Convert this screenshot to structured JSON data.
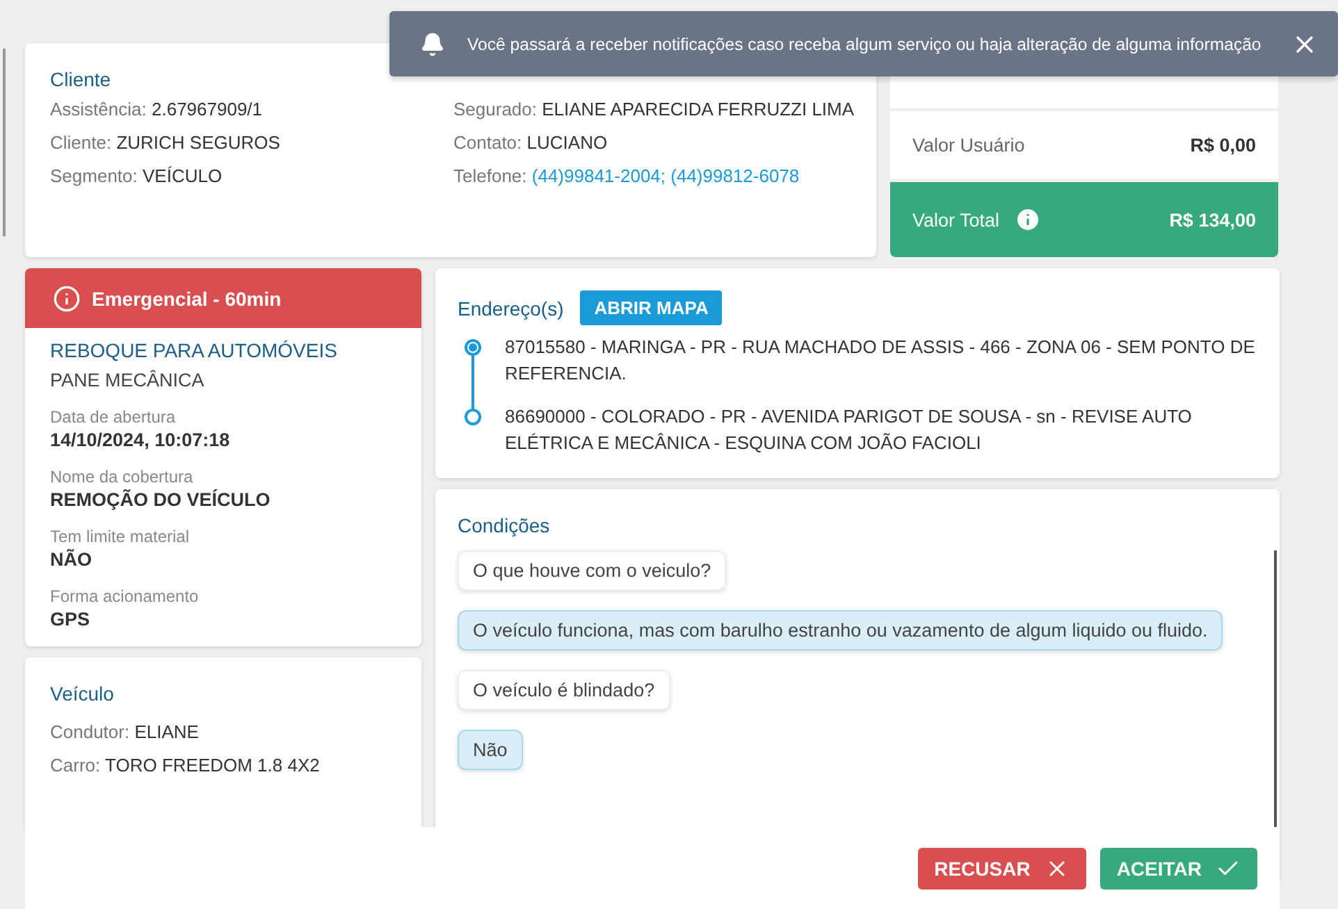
{
  "notification": {
    "text": "Você passará a receber notificações caso receba algum serviço ou haja alteração de alguma informação"
  },
  "client": {
    "title": "Cliente",
    "columns": [
      [
        {
          "label": "Assistência:",
          "value": "2.67967909/1",
          "kind": "text"
        },
        {
          "label": "Cliente:",
          "value": "ZURICH SEGUROS",
          "kind": "text"
        },
        {
          "label": "Segmento:",
          "value": "VEÍCULO",
          "kind": "text"
        }
      ],
      [
        {
          "label": "Segurado:",
          "value": "ELIANE APARECIDA FERRUZZI LIMA",
          "kind": "text"
        },
        {
          "label": "Contato:",
          "value": "LUCIANO",
          "kind": "text"
        },
        {
          "label": "Telefone:",
          "value": "(44)99841-2004; (44)99812-6078",
          "kind": "link"
        }
      ]
    ]
  },
  "values": [
    {
      "label": "Valor Usuário",
      "amount": "R$ 0,00",
      "kind": "plain"
    },
    {
      "label": "Valor Total",
      "amount": "R$ 134,00",
      "kind": "total"
    }
  ],
  "service": {
    "priority": "Emergencial - 60min",
    "title": "REBOQUE PARA AUTOMÓVEIS",
    "subtitle": "PANE MECÂNICA",
    "details": [
      {
        "label": "Data de abertura",
        "value": "14/10/2024, 10:07:18"
      },
      {
        "label": "Nome da cobertura",
        "value": "REMOÇÃO DO VEÍCULO"
      },
      {
        "label": "Tem limite material",
        "value": "NÃO"
      },
      {
        "label": "Forma acionamento",
        "value": "GPS"
      }
    ]
  },
  "vehicle": {
    "title": "Veículo",
    "fields": [
      {
        "label": "Condutor:",
        "value": "ELIANE"
      },
      {
        "label": "Carro:",
        "value": "TORO FREEDOM 1.8 4X2"
      }
    ]
  },
  "addresses": {
    "title": "Endereço(s)",
    "map_button": "ABRIR MAPA",
    "stops": [
      {
        "text": "87015580 - MARINGA - PR - RUA MACHADO DE ASSIS - 466 - ZONA 06 - SEM PONTO DE REFERENCIA.",
        "kind": "origin"
      },
      {
        "text": "86690000 - COLORADO - PR - AVENIDA PARIGOT DE SOUSA - sn - REVISE AUTO ELÉTRICA E MECÂNICA - ESQUINA COM JOÃO FACIOLI",
        "kind": "destination"
      }
    ]
  },
  "conditions": {
    "title": "Condições",
    "messages": [
      {
        "text": "O que houve com o veiculo?",
        "kind": "question"
      },
      {
        "text": "O veículo funciona, mas com barulho estranho ou vazamento de algum liquido ou fluido.",
        "kind": "answer"
      },
      {
        "text": "O veículo é blindado?",
        "kind": "question"
      },
      {
        "text": "Não",
        "kind": "answer"
      }
    ]
  },
  "actions": [
    {
      "label": "RECUSAR",
      "kind": "reject"
    },
    {
      "label": "ACEITAR",
      "kind": "accept"
    }
  ]
}
